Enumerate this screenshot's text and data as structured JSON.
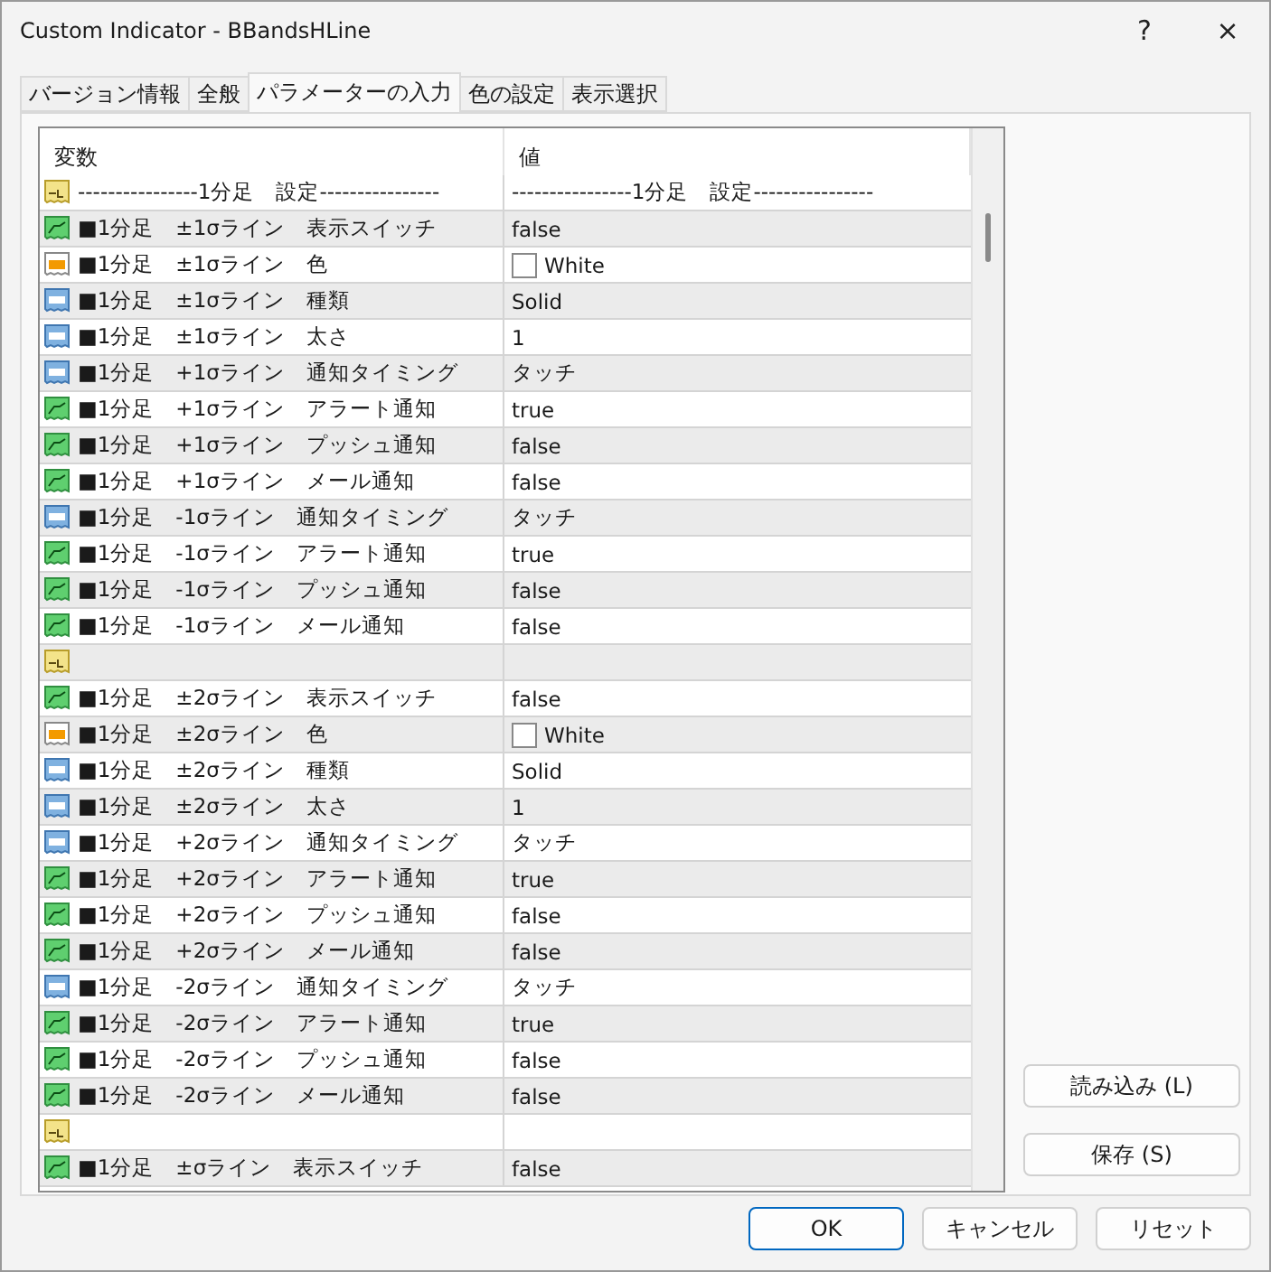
{
  "window": {
    "title": "Custom Indicator - BBandsHLine",
    "help": "?",
    "close": "×"
  },
  "tabs": [
    {
      "label": "バージョン情報",
      "selected": false
    },
    {
      "label": "全般",
      "selected": false
    },
    {
      "label": "パラメーターの入力",
      "selected": true
    },
    {
      "label": "色の設定",
      "selected": false
    },
    {
      "label": "表示選択",
      "selected": false
    }
  ],
  "table": {
    "columns": [
      "変数",
      "値"
    ],
    "rows": [
      {
        "kind": "string",
        "name": "----------------1分足　設定----------------",
        "value": "----------------1分足　設定----------------"
      },
      {
        "kind": "bool",
        "name": "■1分足　±1σライン　表示スイッチ",
        "value": "false"
      },
      {
        "kind": "color",
        "name": "■1分足　±1σライン　色",
        "value": "White",
        "color": "#ffffff"
      },
      {
        "kind": "int",
        "name": "■1分足　±1σライン　種類",
        "value": "Solid"
      },
      {
        "kind": "int",
        "name": "■1分足　±1σライン　太さ",
        "value": "1"
      },
      {
        "kind": "int",
        "name": "■1分足　+1σライン　通知タイミング",
        "value": "タッチ"
      },
      {
        "kind": "bool",
        "name": "■1分足　+1σライン　アラート通知",
        "value": "true"
      },
      {
        "kind": "bool",
        "name": "■1分足　+1σライン　プッシュ通知",
        "value": "false"
      },
      {
        "kind": "bool",
        "name": "■1分足　+1σライン　メール通知",
        "value": "false"
      },
      {
        "kind": "int",
        "name": "■1分足　-1σライン　通知タイミング",
        "value": "タッチ"
      },
      {
        "kind": "bool",
        "name": "■1分足　-1σライン　アラート通知",
        "value": "true"
      },
      {
        "kind": "bool",
        "name": "■1分足　-1σライン　プッシュ通知",
        "value": "false"
      },
      {
        "kind": "bool",
        "name": "■1分足　-1σライン　メール通知",
        "value": "false"
      },
      {
        "kind": "string"
      },
      {
        "kind": "bool",
        "name": "■1分足　±2σライン　表示スイッチ",
        "value": "false"
      },
      {
        "kind": "color",
        "name": "■1分足　±2σライン　色",
        "value": "White",
        "color": "#ffffff"
      },
      {
        "kind": "int",
        "name": "■1分足　±2σライン　種類",
        "value": "Solid"
      },
      {
        "kind": "int",
        "name": "■1分足　±2σライン　太さ",
        "value": "1"
      },
      {
        "kind": "int",
        "name": "■1分足　+2σライン　通知タイミング",
        "value": "タッチ"
      },
      {
        "kind": "bool",
        "name": "■1分足　+2σライン　アラート通知",
        "value": "true"
      },
      {
        "kind": "bool",
        "name": "■1分足　+2σライン　プッシュ通知",
        "value": "false"
      },
      {
        "kind": "bool",
        "name": "■1分足　+2σライン　メール通知",
        "value": "false"
      },
      {
        "kind": "int",
        "name": "■1分足　-2σライン　通知タイミング",
        "value": "タッチ"
      },
      {
        "kind": "bool",
        "name": "■1分足　-2σライン　アラート通知",
        "value": "true"
      },
      {
        "kind": "bool",
        "name": "■1分足　-2σライン　プッシュ通知",
        "value": "false"
      },
      {
        "kind": "bool",
        "name": "■1分足　-2σライン　メール通知",
        "value": "false"
      },
      {
        "kind": "string"
      },
      {
        "kind": "bool",
        "name": "■1分足　±σライン　表示スイッチ",
        "value": "false"
      }
    ]
  },
  "side_buttons": [
    "読み込み (L)",
    "保存 (S)"
  ],
  "buttons": [
    {
      "label": "OK",
      "default": true
    },
    {
      "label": "キャンセル",
      "default": false
    },
    {
      "label": "リセット",
      "default": false
    }
  ]
}
